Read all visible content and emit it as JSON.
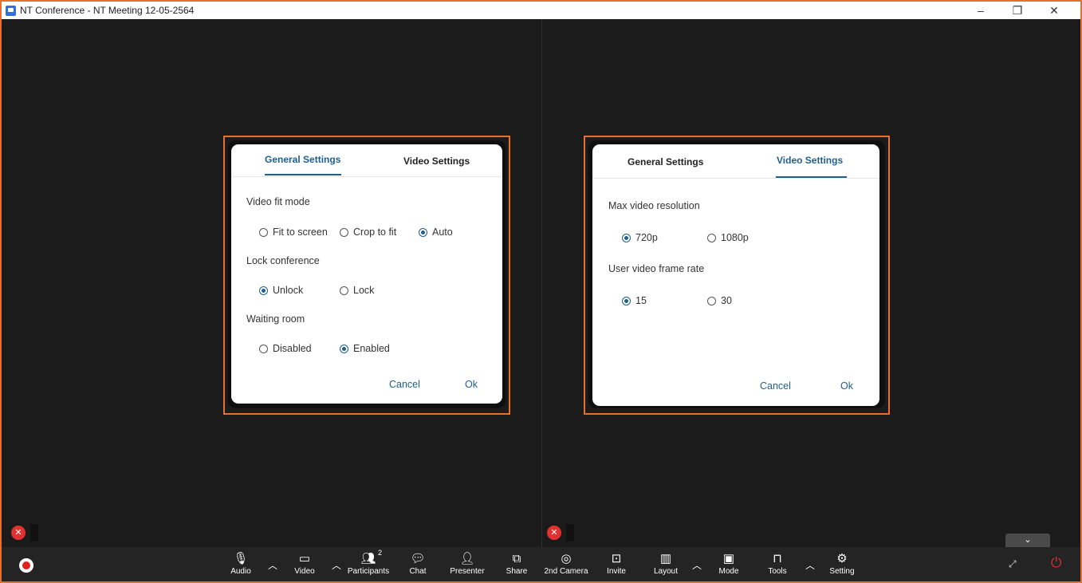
{
  "window": {
    "title": "NT Conference - NT Meeting 12-05-2564",
    "controls": [
      "–",
      "❐",
      "✕"
    ]
  },
  "left_dialog": {
    "tabs": [
      "General Settings",
      "Video Settings"
    ],
    "active_tab": "General Settings",
    "video_fit_mode": {
      "label": "Video fit mode",
      "options": [
        "Fit to screen",
        "Crop to fit",
        "Auto"
      ],
      "selected": "Auto"
    },
    "lock_conference": {
      "label": "Lock conference",
      "options": [
        "Unlock",
        "Lock"
      ],
      "selected": "Unlock"
    },
    "waiting_room": {
      "label": "Waiting room",
      "options": [
        "Disabled",
        "Enabled"
      ],
      "selected": "Enabled"
    },
    "cancel": "Cancel",
    "ok": "Ok"
  },
  "right_dialog": {
    "tabs": [
      "General Settings",
      "Video Settings"
    ],
    "active_tab": "Video Settings",
    "max_resolution": {
      "label": "Max video resolution",
      "options": [
        "720p",
        "1080p"
      ],
      "selected": "720p"
    },
    "frame_rate": {
      "label": "User video frame rate",
      "options": [
        "15",
        "30"
      ],
      "selected": "15"
    },
    "cancel": "Cancel",
    "ok": "Ok"
  },
  "toolbar": {
    "audio": "Audio",
    "video": "Video",
    "participants": "Participants",
    "participants_count": "2",
    "chat": "Chat",
    "presenter": "Presenter",
    "share": "Share",
    "second_camera": "2nd Camera",
    "invite": "Invite",
    "layout": "Layout",
    "mode": "Mode",
    "tools": "Tools",
    "setting": "Setting"
  },
  "colors": {
    "accent_orange": "#e8702a",
    "active_blue": "#1f5e8e",
    "record_red": "#e02020"
  }
}
